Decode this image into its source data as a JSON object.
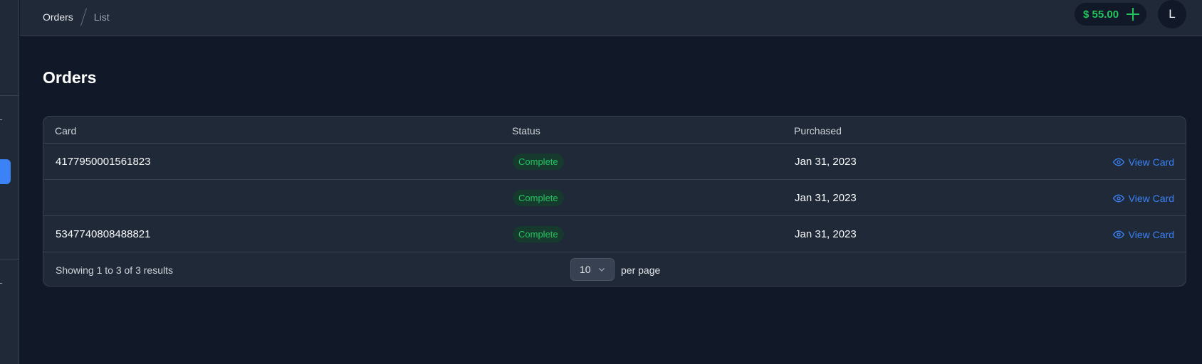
{
  "breadcrumb": {
    "section": "Orders",
    "current": "List"
  },
  "balance": {
    "amount": "$ 55.00",
    "add_icon": "plus-icon"
  },
  "user": {
    "avatar_initial": "L"
  },
  "page": {
    "title": "Orders"
  },
  "table": {
    "columns": {
      "card": "Card",
      "status": "Status",
      "purchased": "Purchased"
    },
    "rows": [
      {
        "card": "4177950001561823",
        "status": "Complete",
        "purchased": "Jan 31, 2023",
        "action": "View Card"
      },
      {
        "card": "",
        "status": "Complete",
        "purchased": "Jan 31, 2023",
        "action": "View Card"
      },
      {
        "card": "5347740808488821",
        "status": "Complete",
        "purchased": "Jan 31, 2023",
        "action": "View Card"
      }
    ]
  },
  "pagination": {
    "summary": "Showing 1 to 3 of 3 results",
    "per_page_value": "10",
    "per_page_label": "per page"
  },
  "colors": {
    "accent": "#3b82f6",
    "success": "#22c55e",
    "background": "#111827",
    "surface": "#1f2937"
  }
}
